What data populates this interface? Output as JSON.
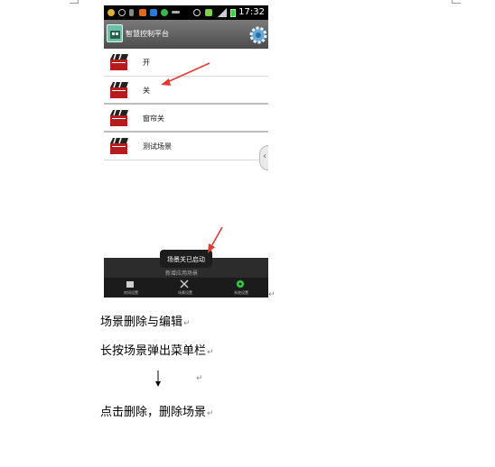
{
  "phone": {
    "status_time": "17:32",
    "app_title": "智慧控制平台",
    "scenes": [
      {
        "label": "开"
      },
      {
        "label": "关"
      },
      {
        "label": "窗帘关"
      },
      {
        "label": "测试场景"
      }
    ],
    "toast": "场景关已启动",
    "bottom_hint": "新增应用场景",
    "nav": [
      {
        "label": "房间设置"
      },
      {
        "label": "场景设置"
      },
      {
        "label": "系统设置"
      }
    ]
  },
  "document": {
    "line1": "场景删除与编辑",
    "line2": "长按场景弹出菜单栏",
    "line3": "点击删除，删除场景",
    "paragraph_mark": "↵"
  },
  "colors": {
    "annotation_arrow": "#e53935",
    "status_bar": "#000000",
    "app_bar": "#5e5e5e",
    "clapper_red": "#b71c1c",
    "gear_green": "#3cd14a"
  }
}
